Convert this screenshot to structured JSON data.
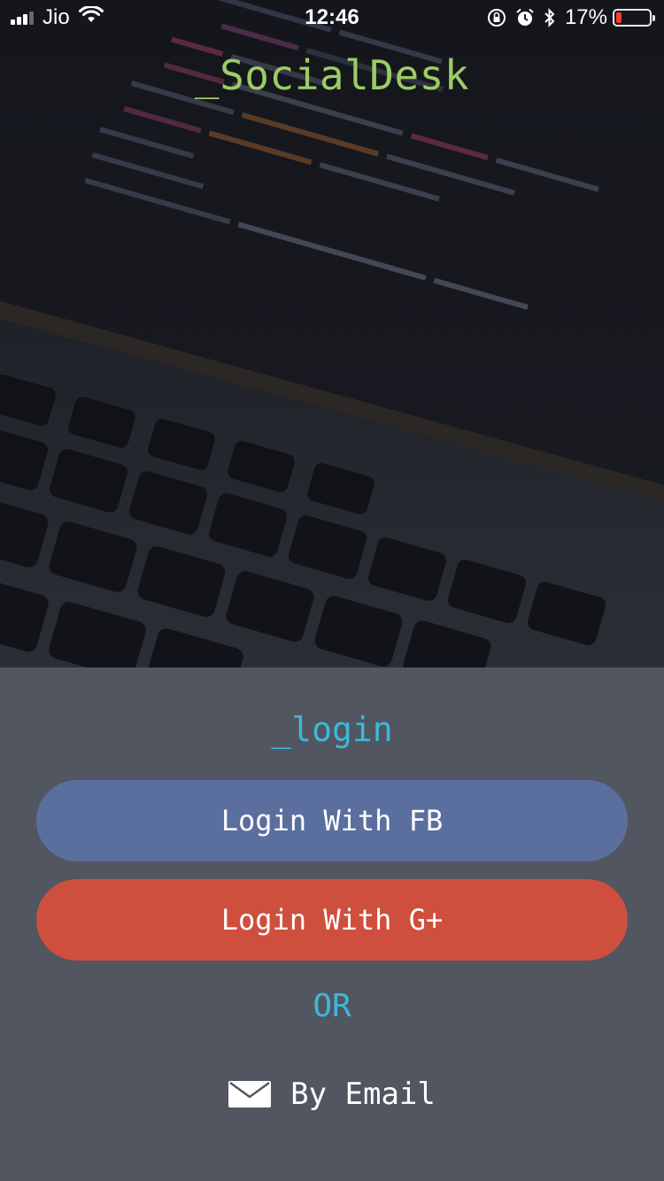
{
  "status_bar": {
    "carrier": "Jio",
    "time": "12:46",
    "battery_percent": "17%",
    "battery_level": 0.17,
    "icons": [
      "signal-icon",
      "wifi-icon",
      "orientation-lock-icon",
      "alarm-icon",
      "bluetooth-icon",
      "battery-icon"
    ]
  },
  "app": {
    "title": "_SocialDesk"
  },
  "login": {
    "heading": "_login",
    "fb_button": "Login With FB",
    "google_button": "Login With G+",
    "or_label": "OR",
    "email_label": "By Email"
  },
  "colors": {
    "title_green": "#9ccc65",
    "accent_cyan": "#3db8d9",
    "facebook_blue": "#5b6f9e",
    "google_red": "#cf4f3e",
    "panel_bg": "#525660"
  }
}
